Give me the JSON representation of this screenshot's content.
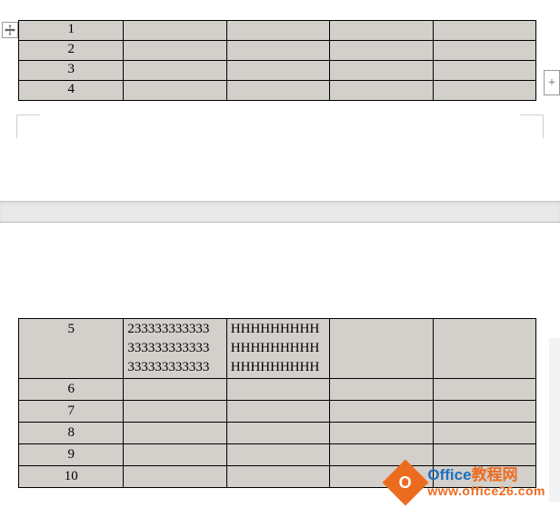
{
  "tables": {
    "top": {
      "rows": [
        {
          "num": "1",
          "c1": "",
          "c2": "",
          "c3": "",
          "c4": ""
        },
        {
          "num": "2",
          "c1": "",
          "c2": "",
          "c3": "",
          "c4": ""
        },
        {
          "num": "3",
          "c1": "",
          "c2": "",
          "c3": "",
          "c4": ""
        },
        {
          "num": "4",
          "c1": "",
          "c2": "",
          "c3": "",
          "c4": ""
        }
      ]
    },
    "bottom": {
      "rows": [
        {
          "num": "5",
          "c1": "233333333333\n333333333333\n333333333333",
          "c2": "HHHHHHHHH\nHHHHHHHHH\nHHHHHHHHH",
          "c3": "",
          "c4": ""
        },
        {
          "num": "6",
          "c1": "",
          "c2": "",
          "c3": "",
          "c4": ""
        },
        {
          "num": "7",
          "c1": "",
          "c2": "",
          "c3": "",
          "c4": ""
        },
        {
          "num": "8",
          "c1": "",
          "c2": "",
          "c3": "",
          "c4": ""
        },
        {
          "num": "9",
          "c1": "",
          "c2": "",
          "c3": "",
          "c4": ""
        },
        {
          "num": "10",
          "c1": "",
          "c2": "",
          "c3": "",
          "c4": ""
        }
      ]
    }
  },
  "watermark": {
    "logo_letter": "O",
    "line1a": "Office",
    "line1b": "教程网",
    "line2": "www.office26.com"
  },
  "icons": {
    "move": "move",
    "add": "+"
  }
}
